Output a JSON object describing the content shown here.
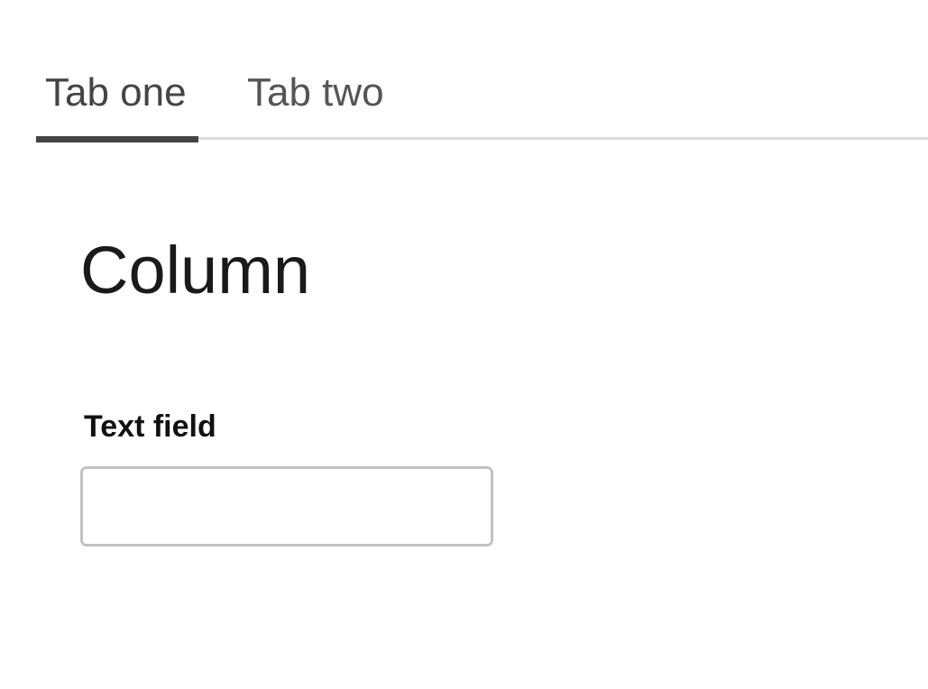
{
  "tabs": [
    {
      "label": "Tab one",
      "active": true
    },
    {
      "label": "Tab two",
      "active": false
    }
  ],
  "main": {
    "title": "Column",
    "field": {
      "label": "Text field",
      "value": "",
      "placeholder": ""
    }
  },
  "colors": {
    "active_tab_indicator": "#444444",
    "tab_divider": "#d9d9d9",
    "input_border": "#c2c2c2",
    "heading_text": "#1a1a1a"
  }
}
